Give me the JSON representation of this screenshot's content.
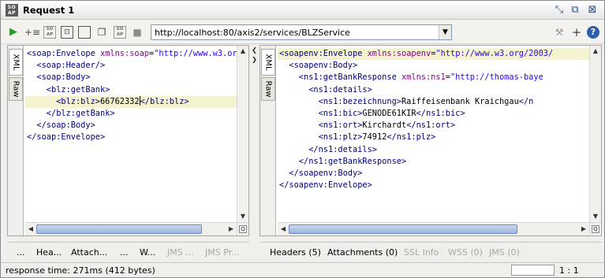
{
  "window": {
    "title": "Request 1",
    "logo": "SOAP"
  },
  "title_icons": [
    "restore-icon",
    "detach-icon",
    "close-icon"
  ],
  "toolbar": {
    "endpoint": "http://localhost:80/axis2/services/BLZService",
    "icons_left": [
      "run-icon",
      "add-assertion-icon",
      "soap-icon",
      "format-icon",
      "maximize-icon",
      "copy-icon",
      "soap-icon",
      "stop-icon"
    ],
    "icons_right": [
      "settings-icon",
      "add-icon",
      "help-icon"
    ]
  },
  "request_pane": {
    "tabs": [
      "XML",
      "Raw"
    ],
    "lines": [
      {
        "indent": 0,
        "parts": [
          [
            "tag",
            "<soap:Envelope "
          ],
          [
            "attr",
            "xmlns:soap"
          ],
          [
            "txt",
            "="
          ],
          [
            "val",
            "\"http://www.w3.or"
          ]
        ]
      },
      {
        "indent": 2,
        "parts": [
          [
            "tag",
            "<soap:Header/>"
          ]
        ]
      },
      {
        "indent": 2,
        "parts": [
          [
            "tag",
            "<soap:Body>"
          ]
        ]
      },
      {
        "indent": 4,
        "parts": [
          [
            "tag",
            "<blz:getBank>"
          ]
        ]
      },
      {
        "indent": 6,
        "parts": [
          [
            "tag",
            "<blz:blz>"
          ],
          [
            "txt",
            "66762332"
          ],
          [
            "caret",
            ""
          ],
          [
            "tag",
            "</blz:blz>"
          ]
        ],
        "highlight": true
      },
      {
        "indent": 4,
        "parts": [
          [
            "tag",
            "</blz:getBank>"
          ]
        ]
      },
      {
        "indent": 2,
        "parts": [
          [
            "tag",
            "</soap:Body>"
          ]
        ]
      },
      {
        "indent": 0,
        "parts": [
          [
            "tag",
            "</soap:Envelope>"
          ]
        ]
      }
    ],
    "bottom_tabs": [
      {
        "label": "...",
        "disabled": false
      },
      {
        "label": "Hea...",
        "disabled": false
      },
      {
        "label": "Attach...",
        "disabled": false
      },
      {
        "label": "...",
        "disabled": false
      },
      {
        "label": "W...",
        "disabled": false
      },
      {
        "label": "JMS ...",
        "disabled": true
      },
      {
        "label": "JMS Pr...",
        "disabled": true
      }
    ]
  },
  "response_pane": {
    "tabs": [
      "XML",
      "Raw"
    ],
    "lines": [
      {
        "indent": 0,
        "parts": [
          [
            "tag",
            "<soapenv:Envelope "
          ],
          [
            "attr",
            "xmlns:soapenv"
          ],
          [
            "txt",
            "="
          ],
          [
            "val",
            "\"http://www.w3.org/2003/"
          ]
        ],
        "highlight": true
      },
      {
        "indent": 2,
        "parts": [
          [
            "tag",
            "<soapenv:Body>"
          ]
        ]
      },
      {
        "indent": 4,
        "parts": [
          [
            "tag",
            "<ns1:getBankResponse "
          ],
          [
            "attr",
            "xmlns:ns1"
          ],
          [
            "txt",
            "="
          ],
          [
            "val",
            "\"http://thomas-baye"
          ]
        ]
      },
      {
        "indent": 6,
        "parts": [
          [
            "tag",
            "<ns1:details>"
          ]
        ]
      },
      {
        "indent": 8,
        "parts": [
          [
            "tag",
            "<ns1:bezeichnung>"
          ],
          [
            "txt",
            "Raiffeisenbank Kraichgau"
          ],
          [
            "tag",
            "</n"
          ]
        ]
      },
      {
        "indent": 8,
        "parts": [
          [
            "tag",
            "<ns1:bic>"
          ],
          [
            "txt",
            "GENODE61KIR"
          ],
          [
            "tag",
            "</ns1:bic>"
          ]
        ]
      },
      {
        "indent": 8,
        "parts": [
          [
            "tag",
            "<ns1:ort>"
          ],
          [
            "txt",
            "Kirchardt"
          ],
          [
            "tag",
            "</ns1:ort>"
          ]
        ]
      },
      {
        "indent": 8,
        "parts": [
          [
            "tag",
            "<ns1:plz>"
          ],
          [
            "txt",
            "74912"
          ],
          [
            "tag",
            "</ns1:plz>"
          ]
        ]
      },
      {
        "indent": 6,
        "parts": [
          [
            "tag",
            "</ns1:details>"
          ]
        ]
      },
      {
        "indent": 4,
        "parts": [
          [
            "tag",
            "</ns1:getBankResponse>"
          ]
        ]
      },
      {
        "indent": 2,
        "parts": [
          [
            "tag",
            "</soapenv:Body>"
          ]
        ]
      },
      {
        "indent": 0,
        "parts": [
          [
            "tag",
            "</soapenv:Envelope>"
          ]
        ]
      }
    ],
    "bottom_tabs": [
      {
        "label": "Headers (5)",
        "disabled": false
      },
      {
        "label": "Attachments (0)",
        "disabled": false
      },
      {
        "label": "SSL Info",
        "disabled": true
      },
      {
        "label": "WSS (0)",
        "disabled": true
      },
      {
        "label": "JMS (0)",
        "disabled": true
      }
    ]
  },
  "status": {
    "response_time": "response time: 271ms (412 bytes)",
    "position": "1 : 1"
  },
  "colors": {
    "tag": "#000080",
    "attr": "#7f007f",
    "value": "#2a00ff",
    "highlight": "#f5f3cf"
  }
}
